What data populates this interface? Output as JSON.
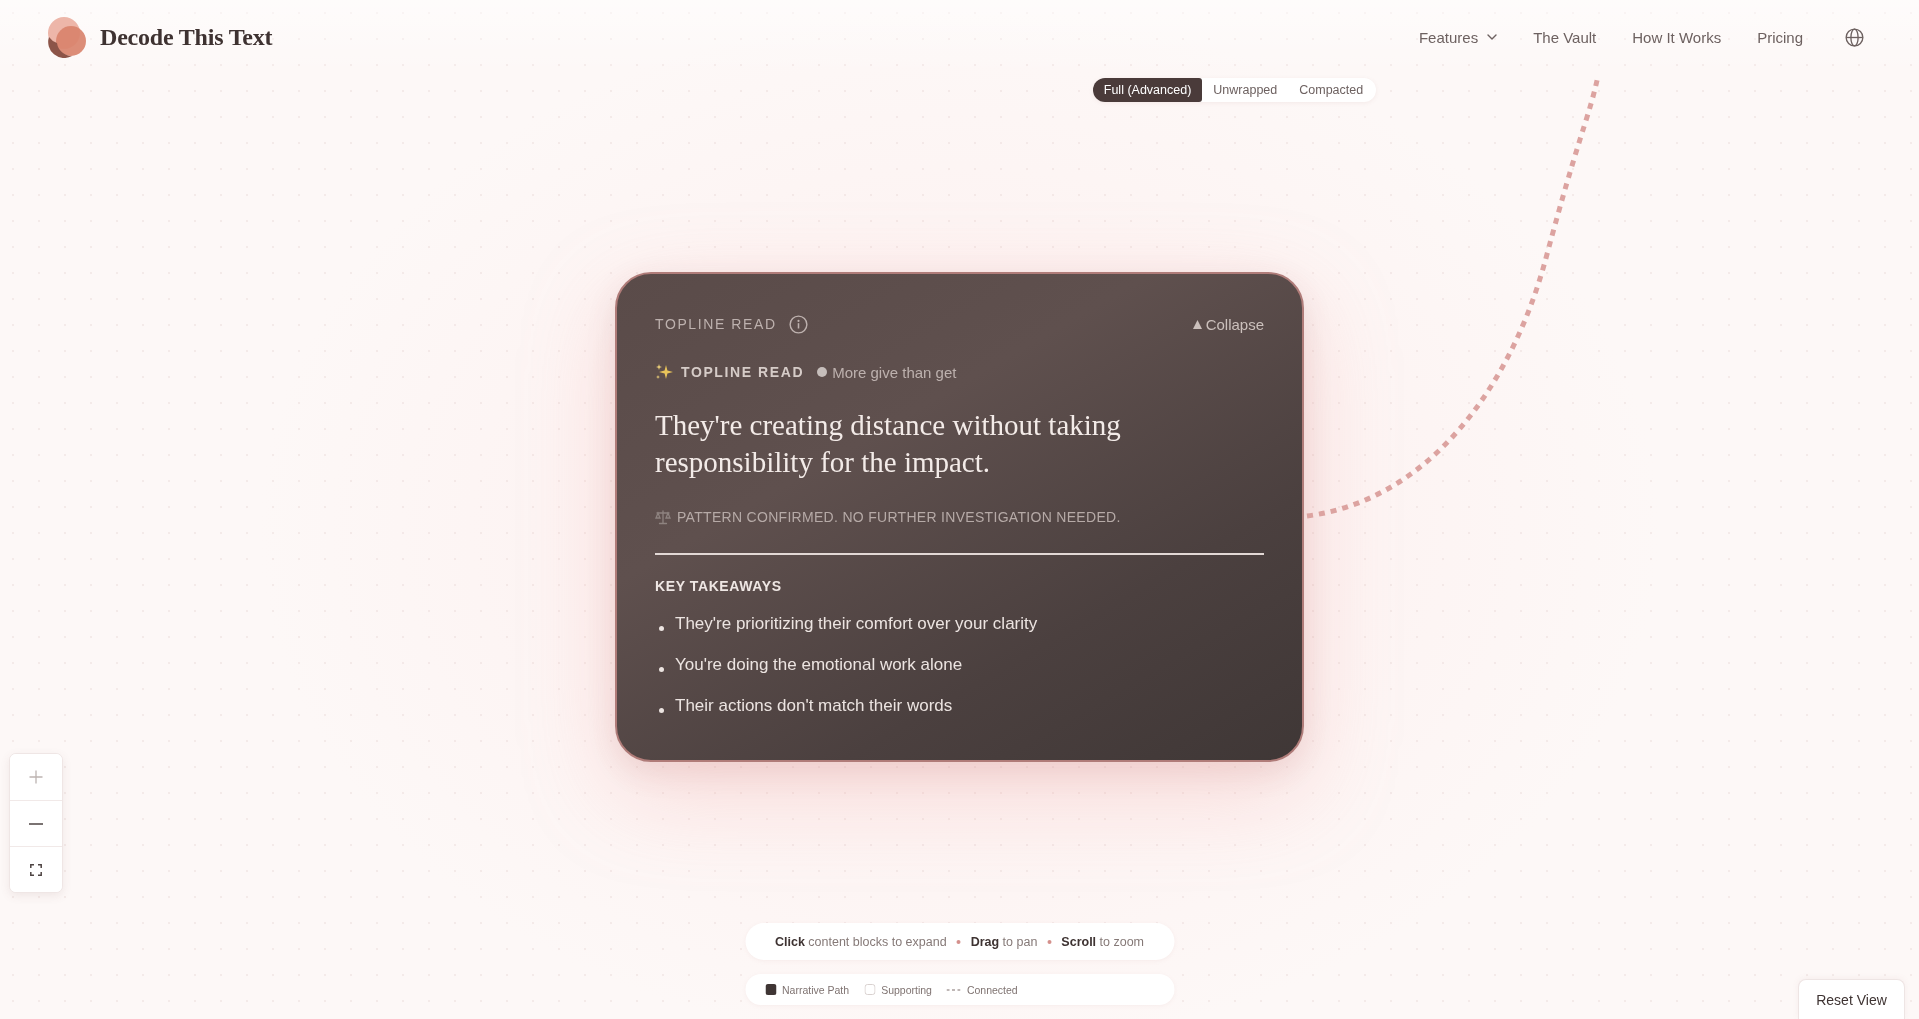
{
  "brand": {
    "name": "Decode This Text"
  },
  "nav": [
    {
      "label": "Features",
      "kind": "dropdown"
    },
    {
      "label": "The Vault",
      "kind": "link"
    },
    {
      "label": "How It Works",
      "kind": "link"
    },
    {
      "label": "Pricing",
      "kind": "link"
    }
  ],
  "view_modes": [
    {
      "label": "Full (Advanced)",
      "selected": true
    },
    {
      "label": "Unwrapped",
      "selected": false
    },
    {
      "label": "Compacted",
      "selected": false
    }
  ],
  "card": {
    "section_title": "TOPLINE READ",
    "collapse_label": "Collapse",
    "tag": "TOPLINE READ",
    "tone": "More give than get",
    "headline": "They're creating distance without taking responsibility for the impact.",
    "verdict": "PATTERN CONFIRMED. NO FURTHER INVESTIGATION NEEDED.",
    "takeaways_title": "KEY TAKEAWAYS",
    "takeaways": [
      "They're prioritizing their comfort over your clarity",
      "You're doing the emotional work alone",
      "Their actions don't match their words"
    ]
  },
  "zoom_controls": [
    {
      "kind": "zoom-in",
      "disabled": true
    },
    {
      "kind": "zoom-out",
      "disabled": false
    },
    {
      "kind": "fit",
      "disabled": false
    }
  ],
  "hints": [
    "**Click** content blocks to expand",
    "**Drag** to pan",
    "**Scroll** to zoom"
  ],
  "legend": [
    {
      "kind": "filled",
      "label": "Narrative Path"
    },
    {
      "kind": "outline",
      "label": "Supporting"
    },
    {
      "kind": "dashed",
      "label": "Connected"
    }
  ],
  "reset_button": "Reset View"
}
